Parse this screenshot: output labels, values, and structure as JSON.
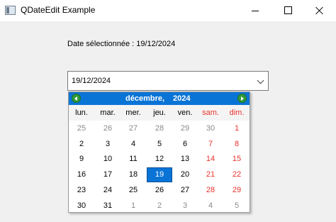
{
  "window": {
    "title": "QDateEdit Example"
  },
  "label": {
    "text": "Date sélectionnée : 19/12/2024"
  },
  "date_edit": {
    "value": "19/12/2024"
  },
  "calendar": {
    "month": "décembre,",
    "year": "2024",
    "weekdays": [
      "lun.",
      "mar.",
      "mer.",
      "jeu.",
      "ven.",
      "sam.",
      "dim."
    ],
    "weeks": [
      [
        "25",
        "26",
        "27",
        "28",
        "29",
        "30",
        "1"
      ],
      [
        "2",
        "3",
        "4",
        "5",
        "6",
        "7",
        "8"
      ],
      [
        "9",
        "10",
        "11",
        "12",
        "13",
        "14",
        "15"
      ],
      [
        "16",
        "17",
        "18",
        "19",
        "20",
        "21",
        "22"
      ],
      [
        "23",
        "24",
        "25",
        "26",
        "27",
        "28",
        "29"
      ],
      [
        "30",
        "31",
        "1",
        "2",
        "3",
        "4",
        "5"
      ]
    ],
    "selected_day": "19",
    "colors": {
      "accent": "#0a74d6",
      "weekend": "#e8322d",
      "other_month": "#8a8a8a"
    }
  }
}
